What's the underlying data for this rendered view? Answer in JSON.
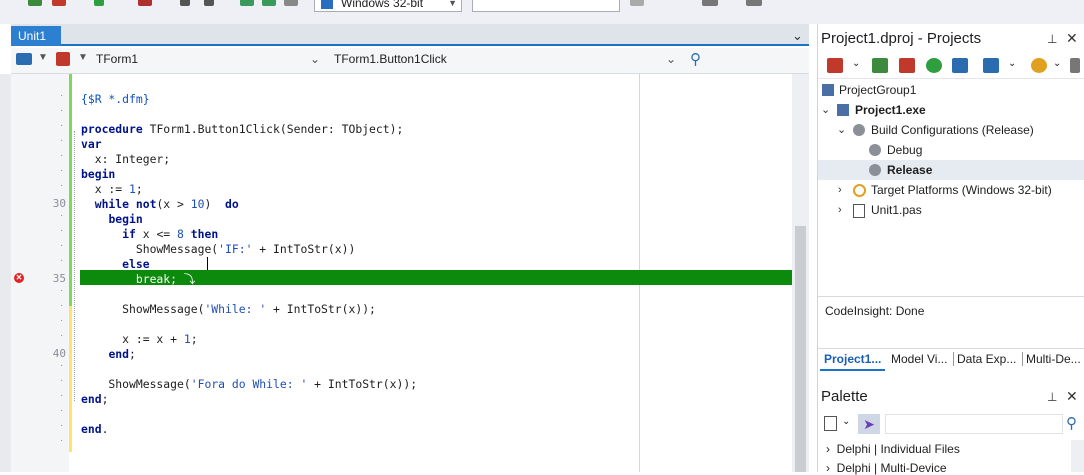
{
  "toolbar": {
    "platform": "Windows 32-bit",
    "config": ""
  },
  "editor": {
    "tab_label": "Unit1",
    "nav_left_combo": "TForm1",
    "nav_right_combo": "TForm1.Button1Click",
    "line_numbers": [
      {
        "n": "30",
        "row": 7
      },
      {
        "n": "35",
        "row": 12
      },
      {
        "n": "40",
        "row": 17
      }
    ],
    "lines": [
      {
        "row": 0,
        "segs": [
          {
            "t": "{$R *.dfm}",
            "c": "dir"
          }
        ]
      },
      {
        "row": 2,
        "segs": [
          {
            "t": "procedure",
            "c": "kw"
          },
          {
            "t": " TForm1.Button1Click(Sender: TObject);",
            "c": ""
          }
        ]
      },
      {
        "row": 3,
        "segs": [
          {
            "t": "var",
            "c": "kw"
          }
        ]
      },
      {
        "row": 4,
        "segs": [
          {
            "t": "  x: Integer;",
            "c": ""
          }
        ]
      },
      {
        "row": 5,
        "segs": [
          {
            "t": "begin",
            "c": "kw"
          }
        ]
      },
      {
        "row": 6,
        "segs": [
          {
            "t": "  x := ",
            "c": ""
          },
          {
            "t": "1",
            "c": "num"
          },
          {
            "t": ";",
            "c": ""
          }
        ]
      },
      {
        "row": 7,
        "segs": [
          {
            "t": "  ",
            "c": ""
          },
          {
            "t": "while",
            "c": "kw"
          },
          {
            "t": " ",
            "c": ""
          },
          {
            "t": "not",
            "c": "kw"
          },
          {
            "t": "(x > ",
            "c": ""
          },
          {
            "t": "10",
            "c": "num"
          },
          {
            "t": ")  ",
            "c": ""
          },
          {
            "t": "do",
            "c": "kw"
          }
        ]
      },
      {
        "row": 8,
        "segs": [
          {
            "t": "    ",
            "c": ""
          },
          {
            "t": "begin",
            "c": "kw"
          }
        ]
      },
      {
        "row": 9,
        "segs": [
          {
            "t": "      ",
            "c": ""
          },
          {
            "t": "if",
            "c": "kw"
          },
          {
            "t": " x <= ",
            "c": ""
          },
          {
            "t": "8",
            "c": "num"
          },
          {
            "t": " ",
            "c": ""
          },
          {
            "t": "then",
            "c": "kw"
          }
        ]
      },
      {
        "row": 10,
        "segs": [
          {
            "t": "        ShowMessage(",
            "c": ""
          },
          {
            "t": "'IF:'",
            "c": "str"
          },
          {
            "t": " + IntToStr(x))",
            "c": ""
          }
        ]
      },
      {
        "row": 11,
        "segs": [
          {
            "t": "      ",
            "c": ""
          },
          {
            "t": "else",
            "c": "kw"
          }
        ]
      },
      {
        "row": 12,
        "segs": [
          {
            "t": "        break; ",
            "c": "brk-kw"
          },
          {
            "t": "⤵",
            "c": "brk-kw"
          }
        ]
      },
      {
        "row": 14,
        "segs": [
          {
            "t": "      ShowMessage(",
            "c": ""
          },
          {
            "t": "'While: '",
            "c": "str"
          },
          {
            "t": " + IntToStr(x));",
            "c": ""
          }
        ]
      },
      {
        "row": 16,
        "segs": [
          {
            "t": "      x := x + ",
            "c": ""
          },
          {
            "t": "1",
            "c": "num"
          },
          {
            "t": ";",
            "c": ""
          }
        ]
      },
      {
        "row": 17,
        "segs": [
          {
            "t": "    ",
            "c": ""
          },
          {
            "t": "end",
            "c": "kw"
          },
          {
            "t": ";",
            "c": ""
          }
        ]
      },
      {
        "row": 19,
        "segs": [
          {
            "t": "    ShowMessage(",
            "c": ""
          },
          {
            "t": "'Fora do While: '",
            "c": "str"
          },
          {
            "t": " + IntToStr(x));",
            "c": ""
          }
        ]
      },
      {
        "row": 20,
        "segs": [
          {
            "t": "end",
            "c": "kw"
          },
          {
            "t": ";",
            "c": ""
          }
        ]
      },
      {
        "row": 22,
        "segs": [
          {
            "t": "end",
            "c": "kw"
          },
          {
            "t": ".",
            "c": ""
          }
        ]
      }
    ]
  },
  "projects": {
    "title": "Project1.dproj - Projects",
    "tree": {
      "group": "ProjectGroup1",
      "project": "Project1.exe",
      "build_configs": "Build Configurations (Release)",
      "debug": "Debug",
      "release": "Release",
      "target_platforms": "Target Platforms (Windows 32-bit)",
      "unit": "Unit1.pas"
    },
    "status": "CodeInsight: Done",
    "tabs": [
      "Project1...",
      "Model Vi...",
      "Data Exp...",
      "Multi-De..."
    ]
  },
  "palette": {
    "title": "Palette",
    "items": [
      "Delphi | Individual Files",
      "Delphi | Multi-Device"
    ]
  },
  "colors": {
    "accent": "#1a73c6",
    "exec_line": "#0c8a0c",
    "error": "#e02424"
  }
}
